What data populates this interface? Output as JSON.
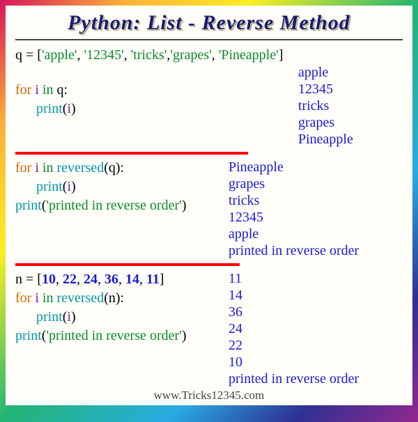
{
  "title": "Python: List - Reverse Method",
  "footer": "www.Tricks12345.com",
  "block1": {
    "assign_var": "q",
    "eq": " = [",
    "s1": "'apple'",
    "c1": ", ",
    "s2": "'12345'",
    "c2": ", ",
    "s3": "'tricks'",
    "c3": ",",
    "s4": "'grapes'",
    "c4": ", ",
    "s5": "'Pineapple'",
    "close": "]",
    "for_kw": "for ",
    "i": "i ",
    "in_kw": "in  ",
    "iter": "q",
    "colon": ":",
    "print": "print",
    "open": "(",
    "arg": "i",
    "closep": ")",
    "out": {
      "o1": "apple",
      "o2": "12345",
      "o3": "tricks",
      "o4": "grapes",
      "o5": "Pineapple"
    }
  },
  "block2": {
    "for_kw": "for ",
    "i": "i ",
    "in_kw": "in  ",
    "rev": "reversed",
    "open": "(",
    "arg": "q",
    "closep": ")",
    "colon": ":",
    "print": "print",
    "popen": "(",
    "parg": "i",
    "pclose": ")",
    "print2": "print",
    "p2open": "(",
    "msg": "'printed in reverse order'",
    "p2close": ")",
    "out": {
      "o1": "Pineapple",
      "o2": "grapes",
      "o3": "tricks",
      "o4": "12345",
      "o5": "apple",
      "o6": "printed in reverse order"
    }
  },
  "block3": {
    "assign_var": "n",
    "eq": " = [",
    "v1": "10",
    "v2": "22",
    "v3": "24",
    "v4": "36",
    "v5": "14",
    "v6": "11",
    "close": "]",
    "sep": ", ",
    "for_kw": "for ",
    "i": "i ",
    "in_kw": "in  ",
    "rev": "reversed",
    "open": "(",
    "arg": "n",
    "closep": ")",
    "colon": ":",
    "print": "print",
    "popen": "(",
    "parg": "i",
    "pclose": ")",
    "print2": "print",
    "p2open": "(",
    "msg": "'printed in reverse order'",
    "p2close": ")",
    "out": {
      "o1": "11",
      "o2": "14",
      "o3": "36",
      "o4": "24",
      "o5": "22",
      "o6": "10",
      "o7": "printed in reverse order"
    }
  }
}
